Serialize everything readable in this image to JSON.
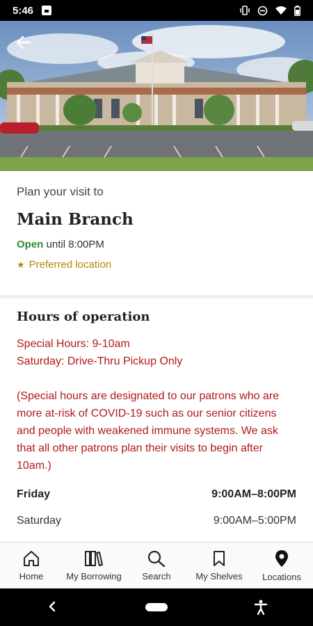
{
  "status_bar": {
    "time": "5:46"
  },
  "header": {
    "back_icon": "arrow-left-icon"
  },
  "summary": {
    "plan_label": "Plan your visit to",
    "branch_name": "Main Branch",
    "open_status": "Open",
    "open_until": " until 8:00PM",
    "preferred_label": "Preferred location",
    "preferred_icon": "star-icon",
    "open_color": "#2f8a2f",
    "preferred_color": "#b8860b"
  },
  "hours": {
    "title": "Hours of operation",
    "special_line1": "Special Hours: 9-10am",
    "special_line2": "Saturday: Drive-Thru Pickup Only",
    "note": "(Special hours are designated to our patrons who are more at-risk of COVID-19 such as our senior citizens and people with weakened immune systems. We ask that all other patrons plan their visits to begin after 10am.)",
    "alert_color": "#b01818",
    "rows": [
      {
        "day": "Friday",
        "time": "9:00AM–8:00PM"
      },
      {
        "day": "Saturday",
        "time": "9:00AM–5:00PM"
      }
    ]
  },
  "bottom_nav": {
    "items": [
      {
        "label": "Home",
        "icon": "home-icon"
      },
      {
        "label": "My Borrowing",
        "icon": "books-icon"
      },
      {
        "label": "Search",
        "icon": "search-icon"
      },
      {
        "label": "My Shelves",
        "icon": "bookmark-icon"
      },
      {
        "label": "Locations",
        "icon": "location-pin-icon"
      }
    ]
  },
  "system_nav": {
    "back_icon": "chevron-left-icon",
    "home_icon": "home-pill-icon",
    "accessibility_icon": "accessibility-icon"
  }
}
